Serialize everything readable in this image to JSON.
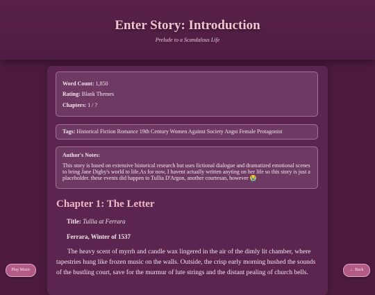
{
  "header": {
    "title": "Enter Story: Introduction",
    "subtitle": "Prelude to a Scandalous Life"
  },
  "info": {
    "word_count_label": "Word Count:",
    "word_count": "1,850",
    "rating_label": "Rating:",
    "rating": "Blank Themes",
    "chapters_label": "Chapters:",
    "chapters": "1 / ?"
  },
  "tags": {
    "label": "Tags:",
    "value": "Historical Fiction Romance 19th Century Women Against Society Angst Female Protagonist"
  },
  "notes": {
    "label": "Author's Notes:",
    "text": "This story is based on extensive historical research but uses fictional dialogue and dramatized emotional scenes to bring Jane Digby's world to life.As for now, I havent actually written anyting on her life so this story is just a placeholder. these events did happen to Tullia D'Argon, another courtesan, however 😭"
  },
  "chapter": {
    "heading": "Chapter 1: The Letter",
    "title_label": "Title:",
    "title_value": "Tullia at Ferrara",
    "place": "Ferrara, Winter of 1537",
    "paragraph": "The heavy scent of myrrh and candle wax lingered in the air of the dimly lit chamber, where tapestries hung like frozen music on the walls. Outside, the crisp early morning hushed the sounds of the bustling court, save for the murmur of lute strings and the distant pealing of church bells."
  },
  "buttons": {
    "play_music": "Play Music",
    "back": "← Back"
  }
}
